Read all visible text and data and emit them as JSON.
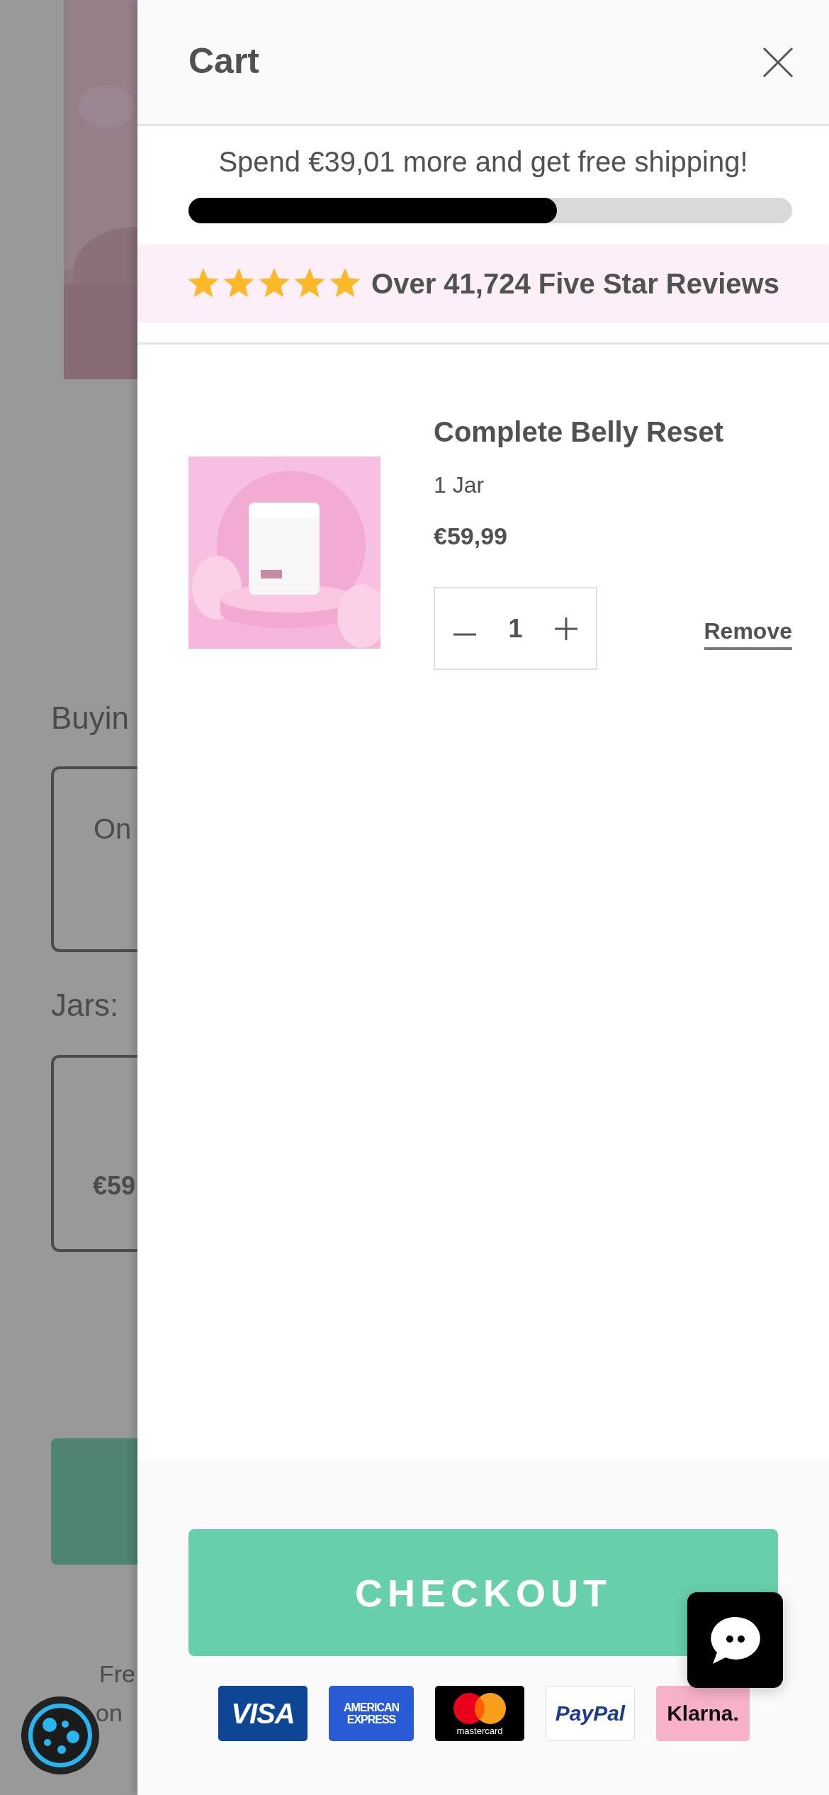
{
  "background_page": {
    "heading": "Buyin",
    "option_card": {
      "label": "On"
    },
    "jars_label": "Jars:",
    "jar_card": {
      "price": "€59"
    },
    "footer_lines": [
      "Fre",
      "on"
    ]
  },
  "cart": {
    "title": "Cart",
    "shipping": {
      "message": "Spend €39,01 more and get free shipping!",
      "level": 0.61
    },
    "reviews": {
      "stars": 5,
      "text": "Over 41,724 Five Star Reviews"
    },
    "items": [
      {
        "name": "Complete Belly Reset",
        "variant": "1 Jar",
        "price": "€59,99",
        "quantity": "1",
        "remove_label": "Remove"
      }
    ],
    "checkout_label": "CHECKOUT",
    "payment_methods": [
      {
        "kind": "visa",
        "label": "VISA"
      },
      {
        "kind": "amex",
        "label": "AMERICAN EXPRESS"
      },
      {
        "kind": "mastercard",
        "label": "mastercard"
      },
      {
        "kind": "paypal",
        "label": "PayPal"
      },
      {
        "kind": "klarna",
        "label": "Klarna."
      }
    ]
  }
}
